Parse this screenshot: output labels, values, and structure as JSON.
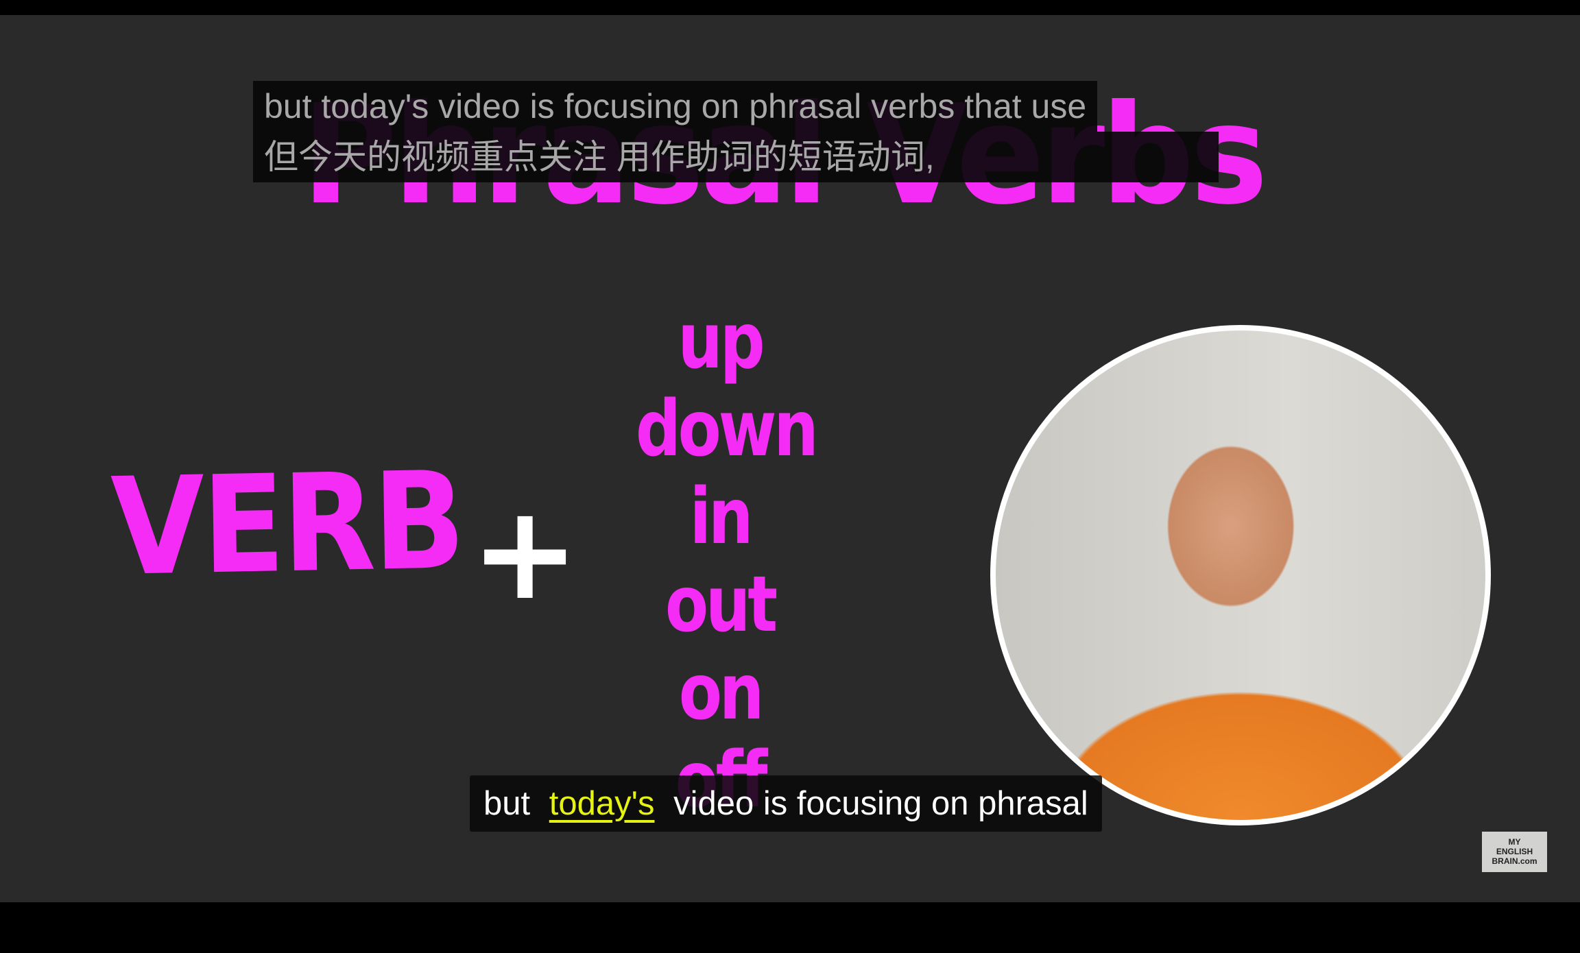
{
  "slide": {
    "title": "Phrasal Verbs",
    "verb": "VERB",
    "plus": "+",
    "particles": [
      "up",
      "down",
      "in",
      "out",
      "on",
      "off"
    ]
  },
  "subtitles_top": {
    "line1": "but today's video is focusing on phrasal verbs that use",
    "line2": "但今天的视频重点关注 用作助词的短语动词,"
  },
  "caption": {
    "before": "but",
    "highlight": "today's",
    "after": "video is focusing on phrasal"
  },
  "logo": {
    "line1": "MY",
    "line2": "ENGLISH",
    "line3": "BRAIN.com"
  },
  "colors": {
    "accent": "#f52cf5",
    "highlight": "#e6f312"
  }
}
